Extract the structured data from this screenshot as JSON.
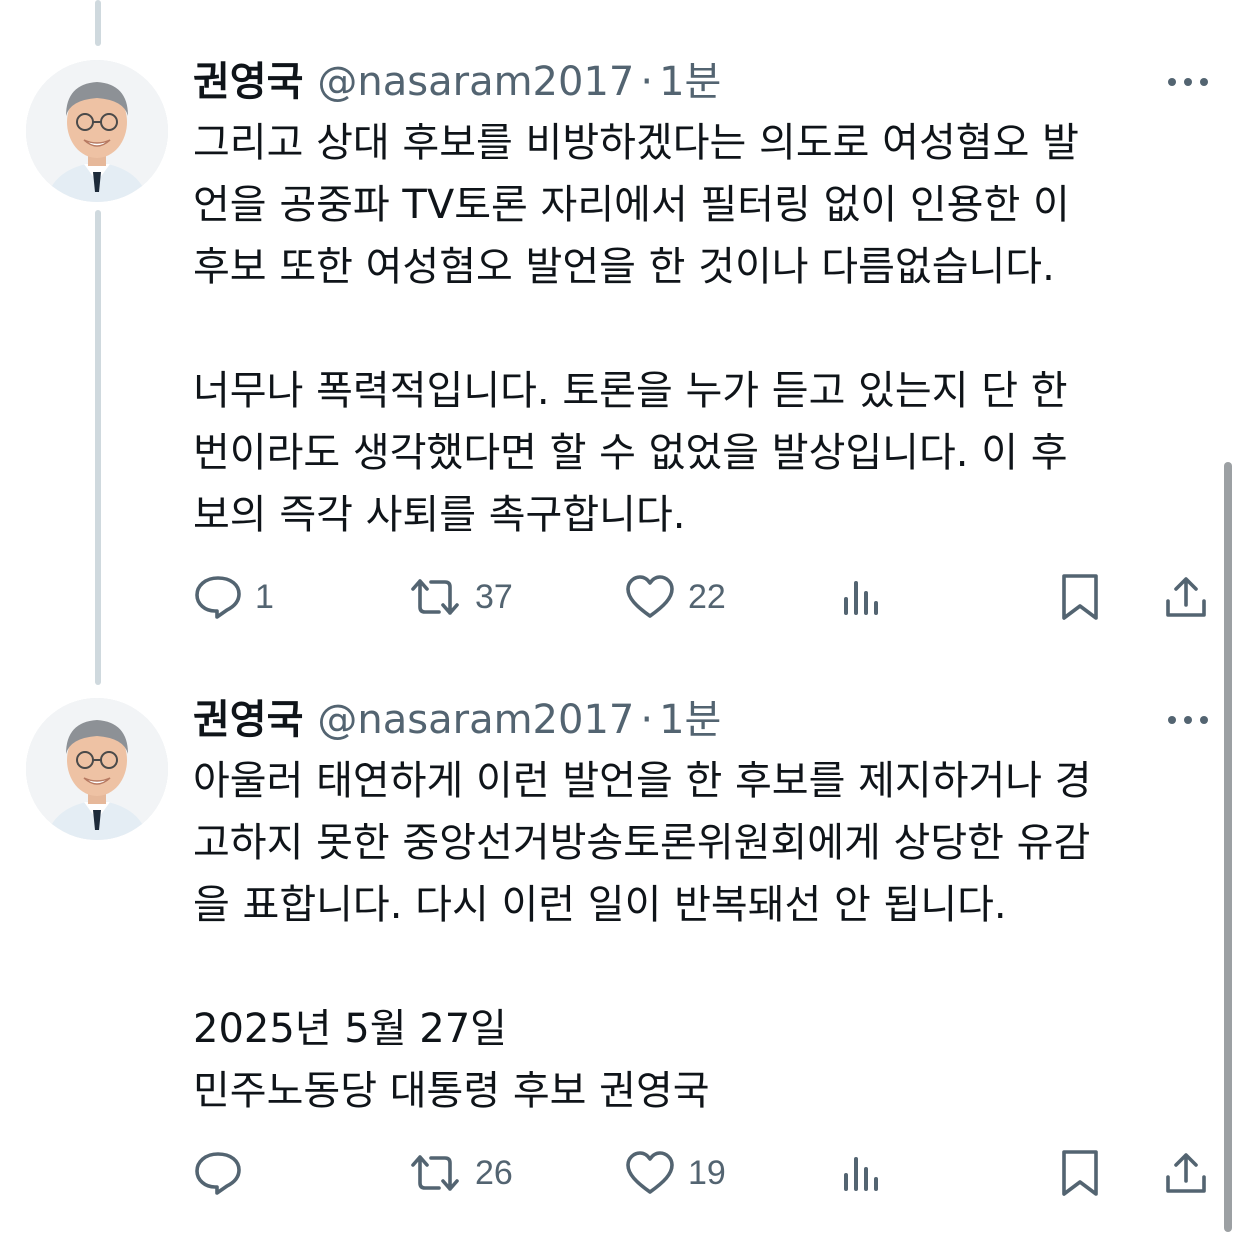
{
  "tweets": [
    {
      "author_name": "권영국",
      "handle": "@nasaram2017",
      "separator": "·",
      "time": "1분",
      "text": "그리고 상대 후보를 비방하겠다는 의도로 여성혐오 발\n언을 공중파 TV토론 자리에서 필터링 없이 인용한 이\n후보 또한 여성혐오 발언을 한 것이나 다름없습니다.\n\n너무나 폭력적입니다. 토론을 누가 듣고 있는지 단 한\n번이라도 생각했다면 할 수 없었을 발상입니다. 이 후\n보의 즉각 사퇴를 촉구합니다.",
      "replies": "1",
      "retweets": "37",
      "likes": "22"
    },
    {
      "author_name": "권영국",
      "handle": "@nasaram2017",
      "separator": "·",
      "time": "1분",
      "text": "아울러 태연하게 이런 발언을 한 후보를 제지하거나 경\n고하지 못한 중앙선거방송토론위원회에게 상당한 유감\n을 표합니다. 다시 이런 일이 반복돼선 안 됩니다.\n\n2025년 5월 27일\n민주노동당 대통령 후보 권영국",
      "replies": "",
      "retweets": "26",
      "likes": "19"
    }
  ],
  "icons": {
    "more": "more-dots-icon",
    "reply": "reply-bubble-icon",
    "retweet": "retweet-icon",
    "like": "heart-icon",
    "views": "views-chart-icon",
    "bookmark": "bookmark-icon",
    "share": "share-upload-icon"
  },
  "colors": {
    "text": "#0f1419",
    "secondary": "#536471",
    "thread_line": "#cfd9de"
  }
}
